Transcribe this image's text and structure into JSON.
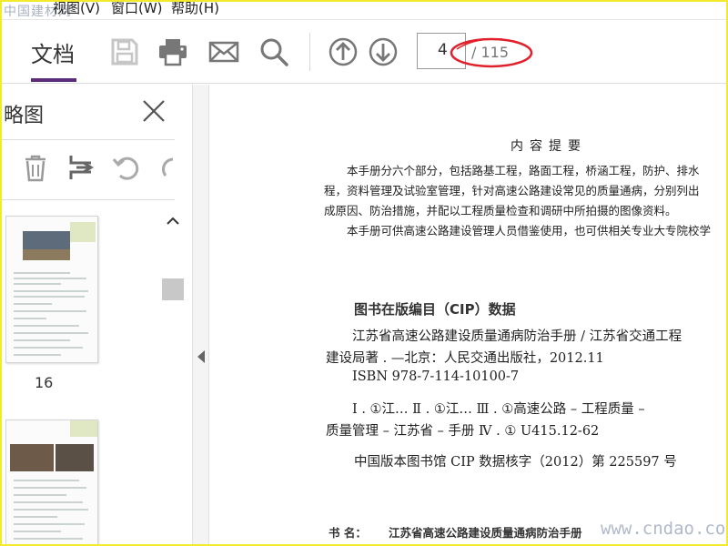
{
  "menubar": {
    "watermark": "中国建材网",
    "items": [
      {
        "label": "视图(V)"
      },
      {
        "label": "窗口(W)"
      },
      {
        "label": "帮助(H)"
      }
    ]
  },
  "toolbar": {
    "tab_label": "文档",
    "page_current": "4",
    "page_total": "/ 115",
    "icons": [
      "save-icon",
      "print-icon",
      "mail-icon",
      "search-icon",
      "arrow-up-icon",
      "arrow-down-icon"
    ],
    "accent_color": "#5b2d78",
    "annotation_color": "#e0202a"
  },
  "sidebar": {
    "title": "略图",
    "tools": [
      "trash-icon",
      "extract-icon",
      "rotate-left-icon",
      "rotate-right-icon"
    ],
    "thumbnails": [
      {
        "label": "16"
      },
      {
        "label": ""
      }
    ]
  },
  "document": {
    "abstract_title": "内容提要",
    "abstract_lines": [
      "本手册分六个部分，包括路基工程，路面工程，桥涵工程，防护、排水",
      "程，资料管理及试验室管理，针对高速公路建设常见的质量通病，分别列出",
      "成原因、防治措施，并配以工程质量检查和调研中所拍摄的图像资料。",
      "本手册可供高速公路建设管理人员借鉴使用，也可供相关专业大专院校学"
    ],
    "cip_title": "图书在版编目（CIP）数据",
    "cip_lines": [
      "江苏省高速公路建设质量通病防治手册 / 江苏省交通工程",
      "建设局著 . —北京：人民交通出版社，2012.11",
      "ISBN 978-7-114-10100-7",
      "Ⅰ . ①江…   Ⅱ . ①江…   Ⅲ . ①高速公路 – 工程质量 –",
      "质量管理 – 江苏省 – 手册   Ⅳ . ① U415.12-62",
      "中国版本图书馆 CIP 数据核字（2012）第 225597 号"
    ],
    "book_label": "书      名：",
    "book_name": "江苏省高速公路建设质量通病防治手册"
  },
  "watermark_bottom": "www.cndao.com"
}
